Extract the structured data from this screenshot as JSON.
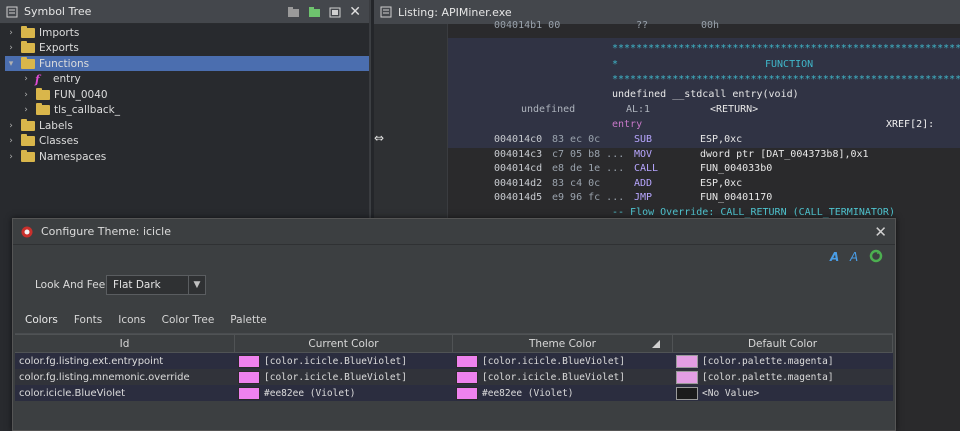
{
  "symbol_tree": {
    "title": "Symbol Tree",
    "items": [
      {
        "label": "Imports",
        "indent": 0,
        "expanded": false,
        "icon": "folder-icon"
      },
      {
        "label": "Exports",
        "indent": 0,
        "expanded": false,
        "icon": "folder-icon"
      },
      {
        "label": "Functions",
        "indent": 0,
        "expanded": true,
        "icon": "folder-icon",
        "selected": true
      },
      {
        "label": "entry",
        "indent": 1,
        "expanded": false,
        "icon": "function-icon"
      },
      {
        "label": "FUN_0040",
        "indent": 1,
        "expanded": false,
        "icon": "folder-icon"
      },
      {
        "label": "tls_callback_",
        "indent": 1,
        "expanded": false,
        "icon": "folder-icon"
      },
      {
        "label": "Labels",
        "indent": 0,
        "expanded": false,
        "icon": "folder-icon"
      },
      {
        "label": "Classes",
        "indent": 0,
        "expanded": false,
        "icon": "folder-icon"
      },
      {
        "label": "Namespaces",
        "indent": 0,
        "expanded": false,
        "icon": "folder-icon"
      }
    ]
  },
  "listing": {
    "title": "Listing:  APIMiner.exe",
    "top_addr": "004014b1 00",
    "top_op": "??",
    "top_val": "00h",
    "stars": "**************************************************************",
    "stars_short": "*",
    "fn_label": "FUNCTION",
    "signature": "undefined __stdcall entry(void)",
    "ret_type": "undefined",
    "ret_reg": "AL:1",
    "ret_name": "<RETURN>",
    "entry_label": "entry",
    "xref": "XREF[2]:",
    "instructions": [
      {
        "addr": "004014c0",
        "bytes": "83 ec 0c",
        "mnemonic": "SUB",
        "operands": "ESP,0xc"
      },
      {
        "addr": "004014c3",
        "bytes": "c7 05 b8 ...",
        "mnemonic": "MOV",
        "operands": "dword ptr [DAT_004373b8],0x1"
      },
      {
        "addr": "004014cd",
        "bytes": "e8 de 1e ...",
        "mnemonic": "CALL",
        "operands": "FUN_004033b0"
      },
      {
        "addr": "004014d2",
        "bytes": "83 c4 0c",
        "mnemonic": "ADD",
        "operands": "ESP,0xc"
      },
      {
        "addr": "004014d5",
        "bytes": "e9 96 fc ...",
        "mnemonic": "JMP",
        "operands": "FUN_00401170"
      }
    ],
    "flow_override": "-- Flow Override: CALL_RETURN (CALL_TERMINATOR)"
  },
  "dialog": {
    "title": "Configure Theme: icicle",
    "laf_label": "Look And Feel:",
    "laf_value": "Flat Dark",
    "tabs": [
      "Colors",
      "Fonts",
      "Icons",
      "Color Tree",
      "Palette"
    ],
    "active_tab": "Colors",
    "columns": [
      "Id",
      "Current Color",
      "Theme Color",
      "Default Color"
    ],
    "rows": [
      {
        "id": "color.fg.listing.ext.entrypoint",
        "current": "[color.icicle.BlueViolet]",
        "current_color": "#ee82ee",
        "theme": "[color.icicle.BlueViolet]",
        "theme_color": "#ee82ee",
        "default": "[color.palette.magenta]",
        "default_color": "#e39ee3"
      },
      {
        "id": "color.fg.listing.mnemonic.override",
        "current": "[color.icicle.BlueViolet]",
        "current_color": "#ee82ee",
        "theme": "[color.icicle.BlueViolet]",
        "theme_color": "#ee82ee",
        "default": "[color.palette.magenta]",
        "default_color": "#e39ee3"
      },
      {
        "id": "color.icicle.BlueViolet",
        "current": "#ee82ee  (Violet)",
        "current_color": "#ee82ee",
        "theme": "#ee82ee  (Violet)",
        "theme_color": "#ee82ee",
        "default": "<No Value>",
        "default_color": "#1b1b1b"
      }
    ]
  },
  "colors": {
    "selection": "#4b6eaf",
    "folder": "#d9b64b",
    "accent": "#4a88c7"
  }
}
